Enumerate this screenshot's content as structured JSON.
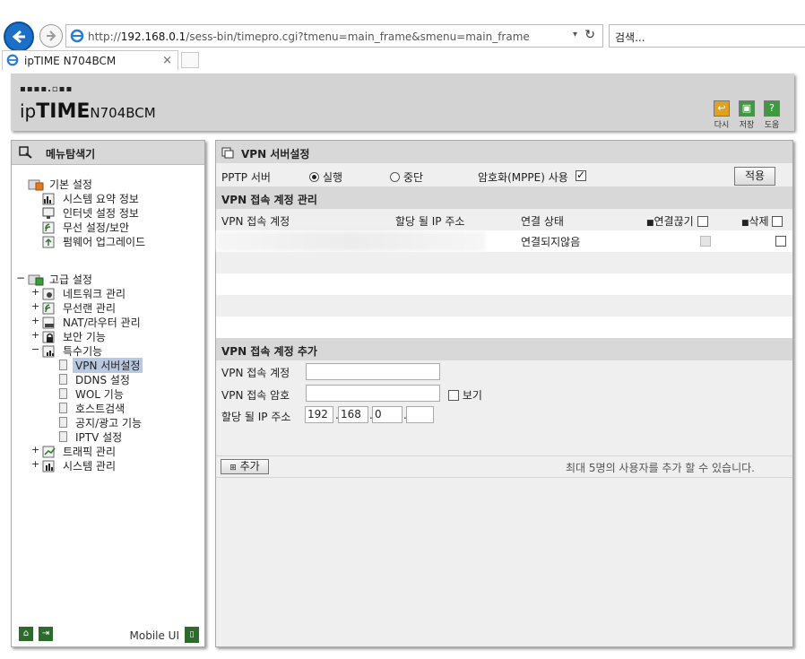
{
  "browser": {
    "url_prefix": "http://",
    "url_host": "192.168.0.1",
    "url_rest": "/sess-bin/timepro.cgi?tmenu=main_frame&smenu=main_frame",
    "search_placeholder": "검색...",
    "tab_title": "ipTIME N704BCM"
  },
  "header": {
    "logo_dots": "▪▪▪▪.▫▪▪",
    "logo_brand_ip": "ip",
    "logo_brand_time": "TIME",
    "logo_model": "N704BCM",
    "buttons": [
      {
        "label": "다시",
        "icon": "reload-icon",
        "color": "#e0a020"
      },
      {
        "label": "저장",
        "icon": "save-icon",
        "color": "#3e9a3e"
      },
      {
        "label": "도움",
        "icon": "help-icon",
        "color": "#3e9a3e"
      }
    ]
  },
  "menu": {
    "title": "메뉴탐색기",
    "basic": {
      "label": "기본 설정",
      "items": [
        "시스템 요약 정보",
        "인터넷 설정 정보",
        "무선 설정/보안",
        "펌웨어 업그레이드"
      ]
    },
    "advanced": {
      "label": "고급 설정",
      "expander": "−",
      "items": [
        {
          "label": "네트워크 관리",
          "expander": "+"
        },
        {
          "label": "무선랜 관리",
          "expander": "+"
        },
        {
          "label": "NAT/라우터 관리",
          "expander": "+"
        },
        {
          "label": "보안 기능",
          "expander": "+"
        },
        {
          "label": "특수기능",
          "expander": "−"
        }
      ],
      "special_items": [
        "VPN 서버설정",
        "DDNS 설정",
        "WOL 기능",
        "호스트검색",
        "공지/광고 기능",
        "IPTV 설정"
      ],
      "after_items": [
        {
          "label": "트래픽 관리",
          "expander": "+"
        },
        {
          "label": "시스템 관리",
          "expander": "+"
        }
      ]
    },
    "mobile_label": "Mobile UI"
  },
  "vpn": {
    "title": "VPN 서버설정",
    "pptp_label": "PPTP 서버",
    "run_label": "실행",
    "stop_label": "중단",
    "mppe_label": "암호화(MPPE) 사용",
    "apply_label": "적용",
    "account_section_title": "VPN 접속 계정 관리",
    "columns": {
      "account": "VPN 접속 계정",
      "ip": "할당 될 IP 주소",
      "status": "연결 상태",
      "disconnect": "연결끊기",
      "delete": "삭제"
    },
    "rows": [
      {
        "status": "연결되지않음"
      }
    ],
    "add_section_title": "VPN 접속 계정 추가",
    "add_account_label": "VPN 접속 계정",
    "add_password_label": "VPN 접속 암호",
    "show_label": "보기",
    "add_ip_label": "할당 될 IP 주소",
    "ip_octets": [
      "192",
      "168",
      "0",
      ""
    ],
    "add_button_label": "추가",
    "max_users_note": "최대 5명의 사용자를 추가 할 수 있습니다."
  }
}
